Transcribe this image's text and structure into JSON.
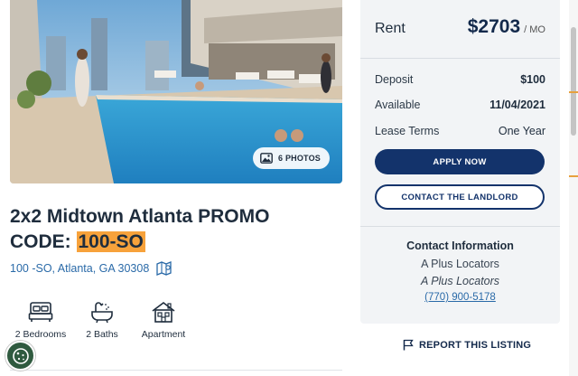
{
  "listing": {
    "title_main": "2x2 Midtown Atlanta PROMO CODE: ",
    "title_code": "100-SO",
    "address": "100 -SO, Atlanta, GA 30308",
    "photos_label": "6 PHOTOS"
  },
  "features": [
    {
      "icon": "bed-icon",
      "label": "2 Bedrooms"
    },
    {
      "icon": "bath-icon",
      "label": "2 Baths"
    },
    {
      "icon": "apartment-icon",
      "label": "Apartment"
    }
  ],
  "pricing": {
    "rent_label": "Rent",
    "rent_value": "$2703",
    "rent_period": "/ MO",
    "deposit_label": "Deposit",
    "deposit_value": "$100",
    "available_label": "Available",
    "available_value": "11/04/2021",
    "lease_label": "Lease Terms",
    "lease_value": "One Year"
  },
  "actions": {
    "apply": "APPLY NOW",
    "contact": "CONTACT THE LANDLORD",
    "report": "REPORT THIS LISTING"
  },
  "contact": {
    "title": "Contact Information",
    "name": "A Plus Locators",
    "company": "A Plus Locators",
    "phone": "(770) 900-5178"
  },
  "colors": {
    "primary": "#13336b",
    "highlight": "#f7a23b",
    "link": "#2a6aa8",
    "panel_bg": "#f2f4f6"
  }
}
